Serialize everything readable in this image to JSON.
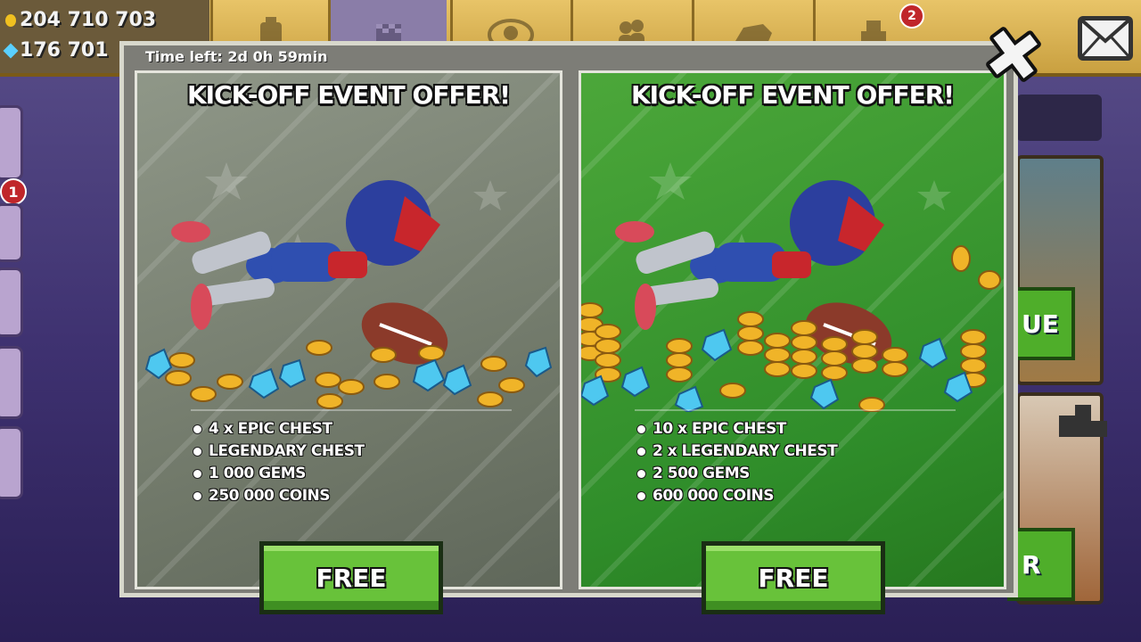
{
  "topbar": {
    "coins": "204 710 703",
    "gems": "176 701",
    "garage_badge": "2"
  },
  "side": {
    "badge": "1"
  },
  "background": {
    "btn_upper": "UE",
    "btn_lower": "R"
  },
  "modal": {
    "time_left": "Time left: 2d 0h 59min",
    "offers": [
      {
        "title": "KICK-OFF EVENT OFFER!",
        "items": [
          "4 x EPIC CHEST",
          "LEGENDARY CHEST",
          "1 000 GEMS",
          "250 000 COINS"
        ],
        "button": "FREE"
      },
      {
        "title": "KICK-OFF EVENT OFFER!",
        "items": [
          "10 x EPIC CHEST",
          "2 x LEGENDARY CHEST",
          "2 500 GEMS",
          "600 000 COINS"
        ],
        "button": "FREE"
      }
    ]
  },
  "colors": {
    "card_grey": "#7a8273",
    "card_green": "#3a9a30",
    "button_green": "#68c23a",
    "topbar_gold": "#d9b252",
    "bg_purple": "#3e3170"
  },
  "icons": [
    "close-icon",
    "mail-icon",
    "fuel-icon",
    "flag-icon",
    "team-icon",
    "friends-icon",
    "car-icon",
    "garage-icon",
    "podium-icon"
  ]
}
